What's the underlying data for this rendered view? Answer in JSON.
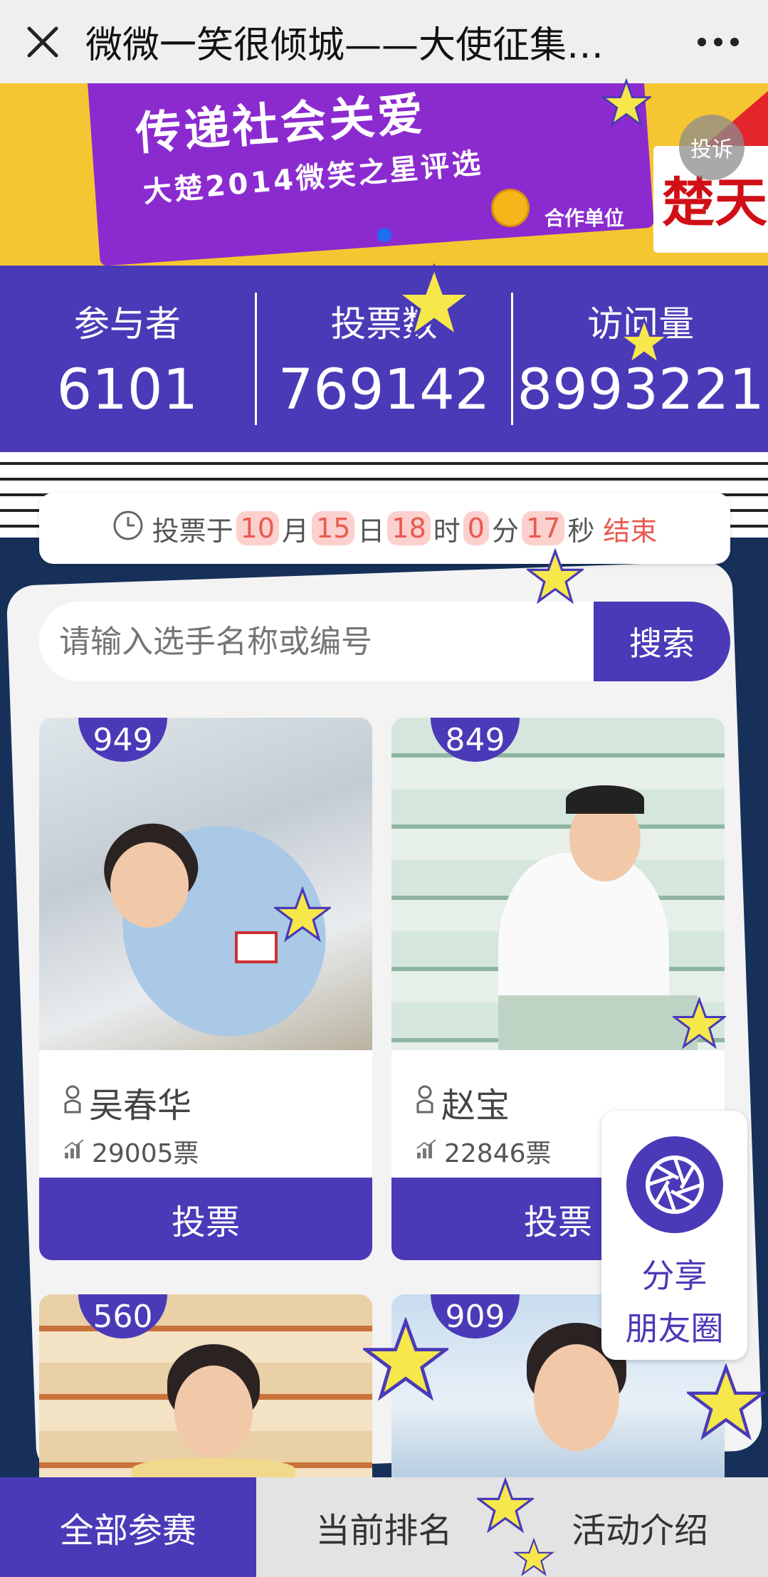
{
  "topbar": {
    "title": "微微一笑很倾城——大使征集火…",
    "close_icon": "close-icon",
    "more_icon": "more-icon"
  },
  "banner": {
    "line1": "传递社会关爱",
    "line2": "大楚2014微笑之星评选",
    "partner": "合作单位",
    "sponsor": "楚天",
    "report": "投诉"
  },
  "stats": [
    {
      "label": "参与者",
      "value": "6101"
    },
    {
      "label": "投票数",
      "value": "769142"
    },
    {
      "label": "访问量",
      "value": "8993221"
    }
  ],
  "countdown": {
    "prefix": "投票于",
    "month": "10",
    "month_unit": "月",
    "day": "15",
    "day_unit": "日",
    "hour": "18",
    "hour_unit": "时",
    "minute": "0",
    "minute_unit": "分",
    "second": "17",
    "second_unit": "秒",
    "suffix": "结束"
  },
  "search": {
    "placeholder": "请输入选手名称或编号",
    "button": "搜索"
  },
  "contestants": [
    {
      "number": "949",
      "name": "吴春华",
      "votes": "29005票",
      "vote_label": "投票"
    },
    {
      "number": "849",
      "name": "赵宝",
      "votes": "22846票",
      "vote_label": "投票"
    },
    {
      "number": "560"
    },
    {
      "number": "909"
    }
  ],
  "share": {
    "line1": "分享",
    "line2": "朋友圈"
  },
  "tabs": [
    {
      "label": "全部参赛",
      "active": true
    },
    {
      "label": "当前排名",
      "active": false
    },
    {
      "label": "活动介绍",
      "active": false
    }
  ],
  "colors": {
    "accent": "#4a3ab8",
    "highlight": "#e85a4f",
    "banner": "#f6c532"
  }
}
